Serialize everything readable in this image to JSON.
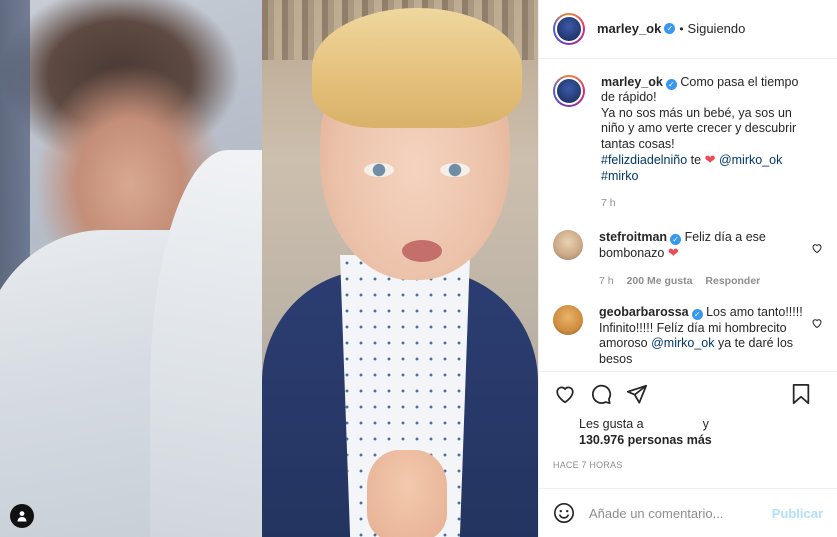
{
  "post": {
    "username": "marley_ok",
    "follow_status": "Siguiendo",
    "separator": "•"
  },
  "caption": {
    "username": "marley_ok",
    "text": "Como pasa el tiempo de rápido!\nYa no sos más un bebé, ya sos un niño y amo verte crecer y descubrir tantas cosas!",
    "hashtag1": "#felizdiadelniño",
    "te": " te ",
    "mention": "@mirko_ok",
    "hashtag2": "#mirko",
    "time": "7 h"
  },
  "comments": [
    {
      "username": "stefroitman",
      "text": "Feliz día a ese bombonazo",
      "time": "7 h",
      "likes": "200 Me gusta",
      "reply": "Responder"
    },
    {
      "username": "geobarbarossa",
      "text": "Los amo tanto!!!!! Infinito!!!!! Felíz día mi hombrecito amoroso ",
      "mention": "@mirko_ok",
      "text_after": " ya te daré los besos"
    }
  ],
  "likes": {
    "prefix": "Les gusta a",
    "connector": "y",
    "count": "130.976 personas más"
  },
  "timestamp": "HACE 7 HORAS",
  "add_comment": {
    "placeholder": "Añade un comentario...",
    "publish": "Publicar"
  },
  "icons": {
    "like": "heart-outline-icon",
    "comment": "comment-bubble-icon",
    "share": "paper-plane-icon",
    "save": "bookmark-icon",
    "emoji": "smiley-icon",
    "tag": "user-tag-icon",
    "verified": "verified-badge-icon"
  },
  "colors": {
    "verified": "#3897f0",
    "heart": "#ed4956",
    "link": "#00376b",
    "publish_disabled": "#b2dffc"
  }
}
